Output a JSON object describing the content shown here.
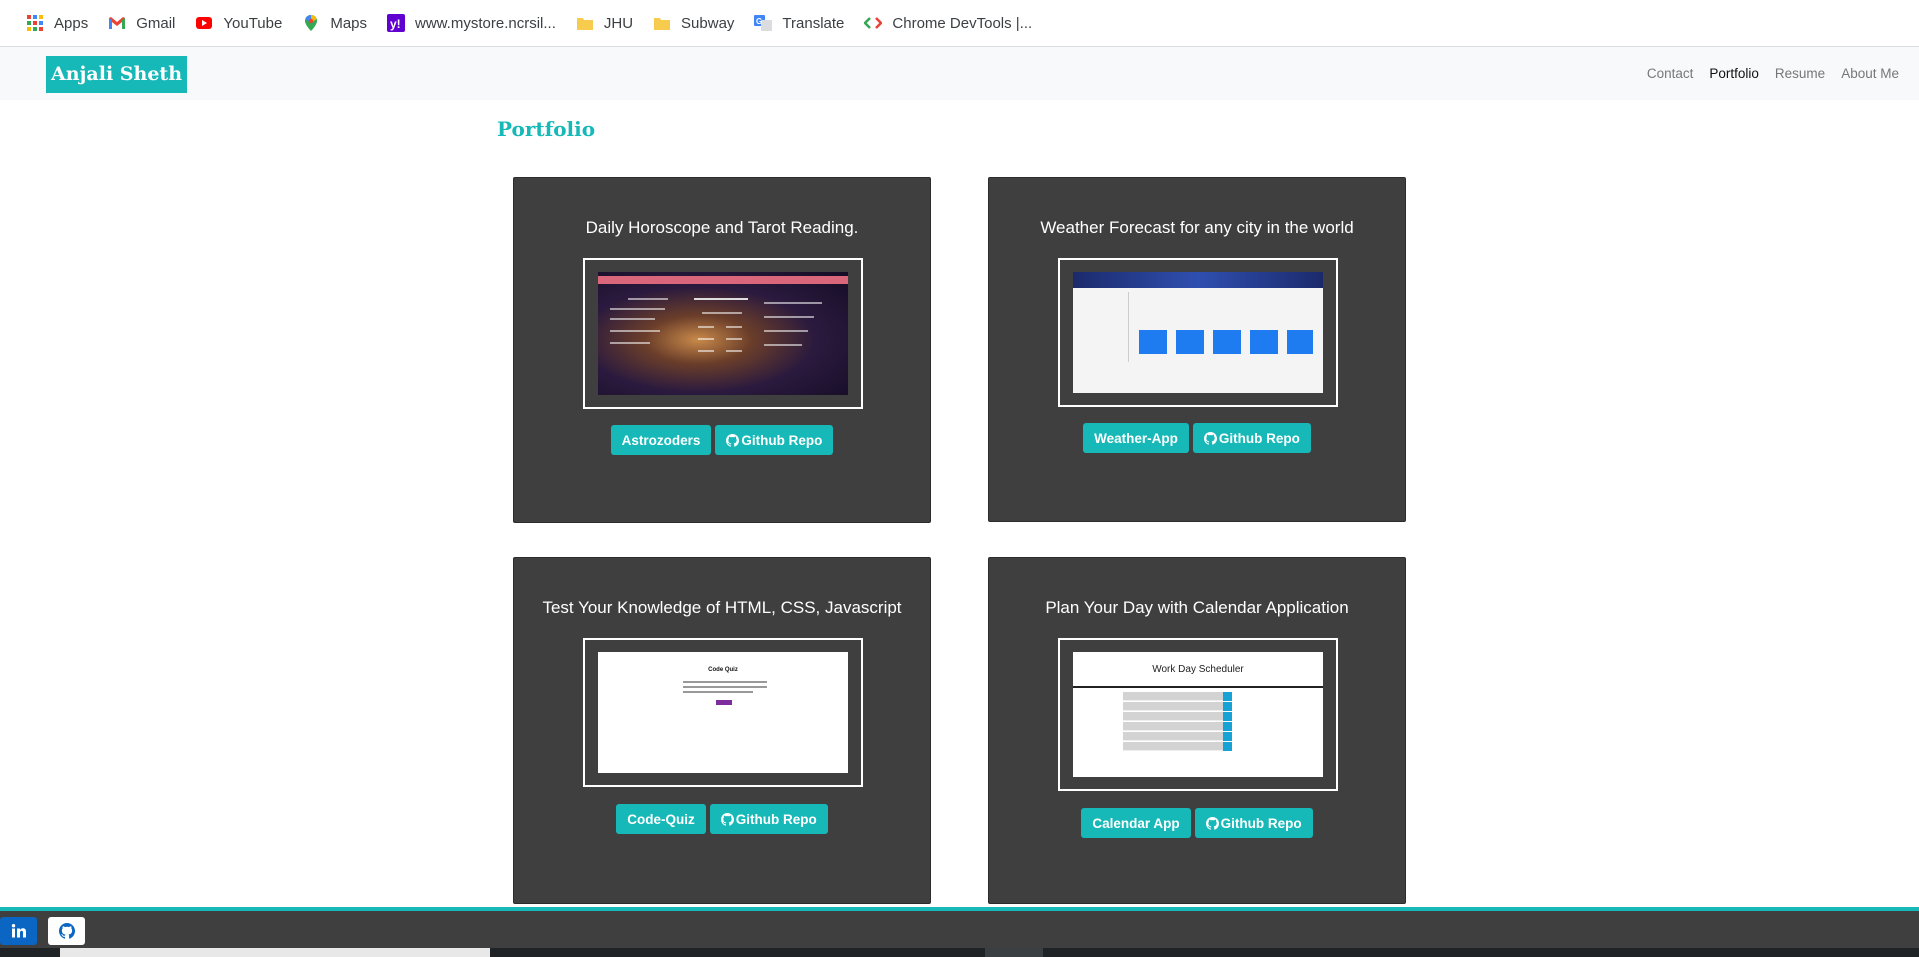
{
  "bookmarks": [
    {
      "label": "Apps",
      "icon": "apps-grid-icon"
    },
    {
      "label": "Gmail",
      "icon": "gmail-icon"
    },
    {
      "label": "YouTube",
      "icon": "youtube-icon"
    },
    {
      "label": "Maps",
      "icon": "maps-pin-icon"
    },
    {
      "label": "www.mystore.ncrsil...",
      "icon": "yahoo-icon"
    },
    {
      "label": "JHU",
      "icon": "folder-icon"
    },
    {
      "label": "Subway",
      "icon": "folder-icon"
    },
    {
      "label": "Translate",
      "icon": "translate-icon"
    },
    {
      "label": "Chrome DevTools |...",
      "icon": "devtools-icon"
    }
  ],
  "navbar": {
    "brand": "Anjali Sheth",
    "links": [
      "Contact",
      "Portfolio",
      "Resume",
      "About Me"
    ],
    "active": "Portfolio"
  },
  "page": {
    "title": "Portfolio"
  },
  "projects": [
    {
      "title": "Daily Horoscope and Tarot Reading.",
      "app_label": "Astrozoders",
      "repo_label": "Github Repo"
    },
    {
      "title": "Weather Forecast for any city in the world",
      "app_label": "Weather-App",
      "repo_label": "Github Repo"
    },
    {
      "title": "Test Your Knowledge of HTML, CSS, Javascript",
      "app_label": "Code-Quiz",
      "repo_label": "Github Repo",
      "screenshot_heading": "Code Quiz"
    },
    {
      "title": "Plan Your Day with Calendar Application",
      "app_label": "Calendar App",
      "repo_label": "Github Repo",
      "screenshot_heading": "Work Day Scheduler"
    }
  ],
  "footer": {
    "links": [
      {
        "name": "linkedin",
        "icon": "linkedin-icon",
        "color": "#0a66c2"
      },
      {
        "name": "github",
        "icon": "github-icon",
        "color": "#ffffff"
      }
    ]
  },
  "colors": {
    "accent": "#17b8b8",
    "card": "#3f3f3f",
    "navbar": "#f8f9fa"
  }
}
